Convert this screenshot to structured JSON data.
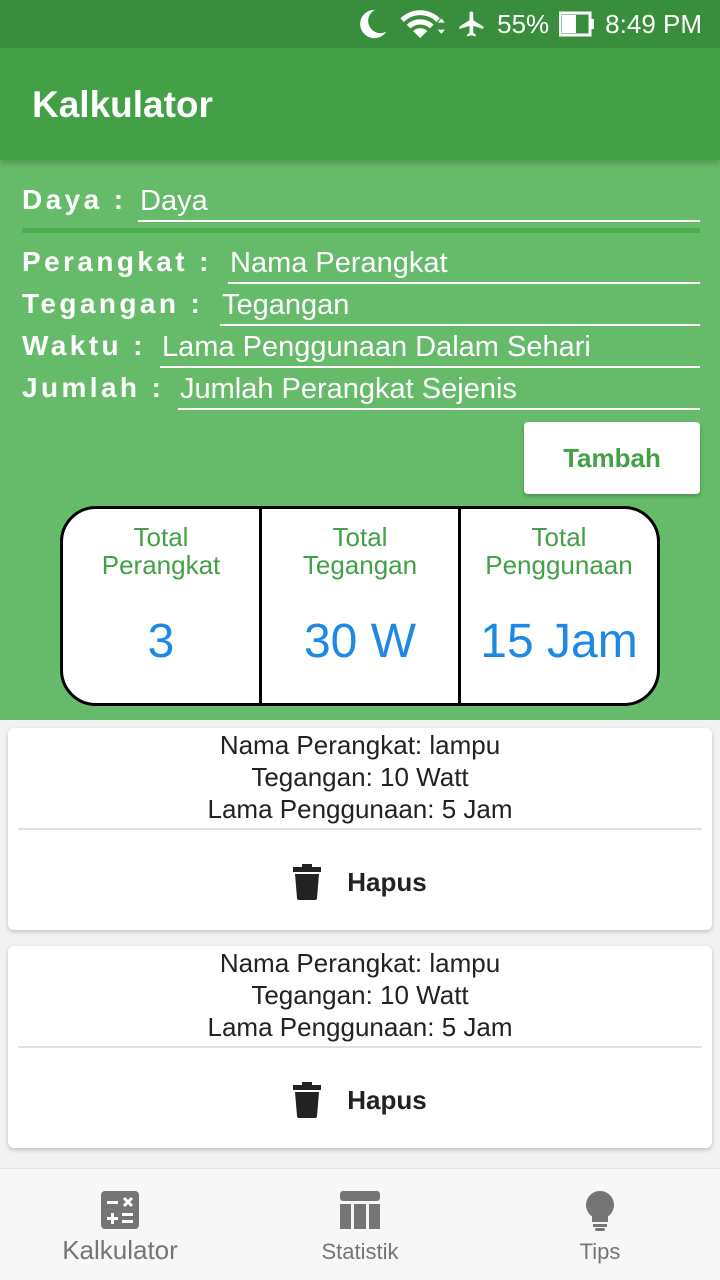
{
  "status_bar": {
    "battery": "55%",
    "time": "8:49 PM"
  },
  "app_bar": {
    "title": "Kalkulator"
  },
  "form": {
    "daya": {
      "label": "Daya :",
      "placeholder": "Daya"
    },
    "perangkat": {
      "label": "Perangkat :",
      "placeholder": "Nama Perangkat"
    },
    "tegangan": {
      "label": "Tegangan :",
      "placeholder": "Tegangan"
    },
    "waktu": {
      "label": "Waktu :",
      "placeholder": "Lama Penggunaan Dalam Sehari"
    },
    "jumlah": {
      "label": "Jumlah :",
      "placeholder": "Jumlah Perangkat Sejenis"
    },
    "add_button": "Tambah"
  },
  "summary": [
    {
      "caption_line1": "Total",
      "caption_line2": "Perangkat",
      "value": "3"
    },
    {
      "caption_line1": "Total",
      "caption_line2": "Tegangan",
      "value": "30 W"
    },
    {
      "caption_line1": "Total",
      "caption_line2": "Penggunaan",
      "value": "15 Jam"
    }
  ],
  "devices": [
    {
      "name": "Nama Perangkat: lampu",
      "voltage": "Tegangan: 10 Watt",
      "usage": "Lama Penggunaan: 5 Jam",
      "delete_label": "Hapus"
    },
    {
      "name": "Nama Perangkat: lampu",
      "voltage": "Tegangan: 10 Watt",
      "usage": "Lama Penggunaan: 5 Jam",
      "delete_label": "Hapus"
    }
  ],
  "bottom_nav": [
    {
      "label": "Kalkulator",
      "icon": "calculator-icon",
      "active": true
    },
    {
      "label": "Statistik",
      "icon": "table-chart-icon",
      "active": false
    },
    {
      "label": "Tips",
      "icon": "lightbulb-icon",
      "active": false
    }
  ],
  "colors": {
    "status_bar": "#388e3c",
    "app_bar": "#43a047",
    "panel": "#66bb6a",
    "accent_green": "#43a047",
    "value_blue": "#1e88e5"
  }
}
